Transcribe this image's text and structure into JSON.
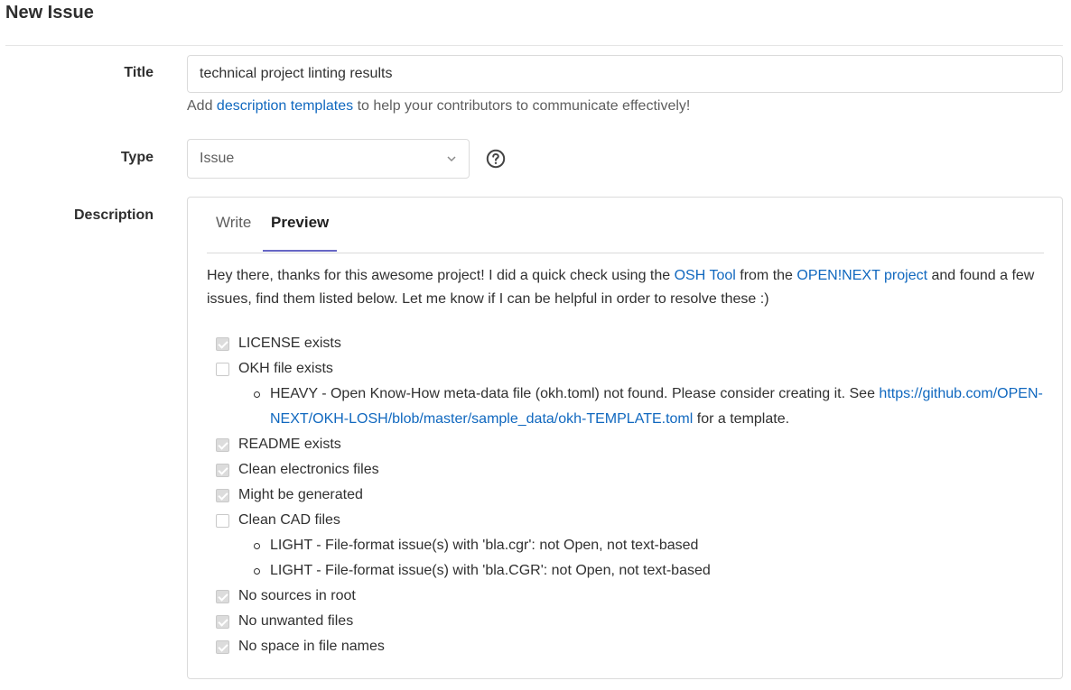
{
  "page": {
    "title": "New Issue"
  },
  "form": {
    "title_label": "Title",
    "title_value": "technical project linting results",
    "hint_prefix": "Add",
    "hint_link": "description templates",
    "hint_suffix": "to help your contributors to communicate effectively!",
    "type_label": "Type",
    "type_value": "Issue",
    "description_label": "Description"
  },
  "description": {
    "tabs": [
      {
        "label": "Write",
        "active": false
      },
      {
        "label": "Preview",
        "active": true
      }
    ],
    "intro": {
      "part1": "Hey there, thanks for this awesome project! I did a quick check using the",
      "link1": "OSH Tool",
      "part2": "from the",
      "link2": "OPEN!NEXT project",
      "part3": "and found a few issues, find them listed below. Let me know if I can be helpful in order to resolve these :)"
    },
    "checklist": [
      {
        "label": "LICENSE exists",
        "checked": true
      },
      {
        "label": "OKH file exists",
        "checked": false,
        "sub": {
          "text": "HEAVY - Open Know-How meta-data file (okh.toml) not found. Please consider creating it. See",
          "link": "https://github.com/OPEN-NEXT/OKH-LOSH/blob/master/sample_data/okh-TEMPLATE.toml",
          "suffix": "for a template."
        }
      },
      {
        "label": "README exists",
        "checked": true
      },
      {
        "label": "Clean electronics files",
        "checked": true
      },
      {
        "label": "Might be generated",
        "checked": true
      },
      {
        "label": "Clean CAD files",
        "checked": false,
        "subs": [
          "LIGHT - File-format issue(s) with 'bla.cgr': not Open, not text-based",
          "LIGHT - File-format issue(s) with 'bla.CGR': not Open, not text-based"
        ]
      },
      {
        "label": "No sources in root",
        "checked": true
      },
      {
        "label": "No unwanted files",
        "checked": true
      },
      {
        "label": "No space in file names",
        "checked": true
      }
    ]
  },
  "colors": {
    "link": "#1068bf",
    "tab_underline": "#6666c4",
    "border": "#dbdbdb"
  }
}
